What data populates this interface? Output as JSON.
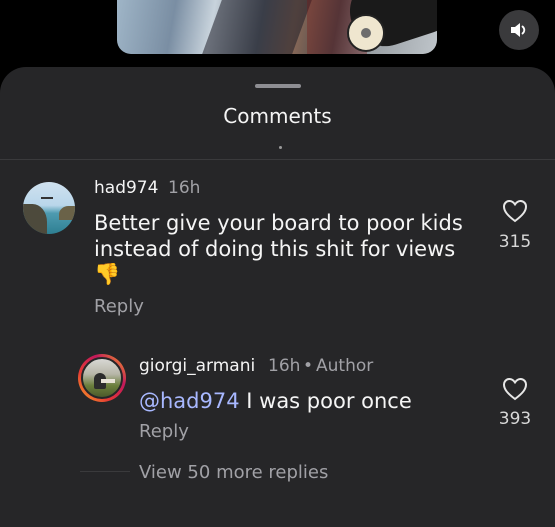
{
  "header": {
    "title": "Comments"
  },
  "comments": [
    {
      "username": "had974",
      "time": "16h",
      "text_line1": "Better give your board to poor kids",
      "text_line2": "instead of doing this shit for views",
      "emoji": "👎",
      "reply_label": "Reply",
      "likes": "315"
    }
  ],
  "replies": [
    {
      "username": "giorgi_armani",
      "time": "16h",
      "separator": "•",
      "badge": "Author",
      "mention": "@had974",
      "text": " I was poor once",
      "reply_label": "Reply",
      "likes": "393"
    }
  ],
  "view_more": "View 50 more replies",
  "icons": {
    "mute": "speaker-icon",
    "like": "heart-icon"
  }
}
